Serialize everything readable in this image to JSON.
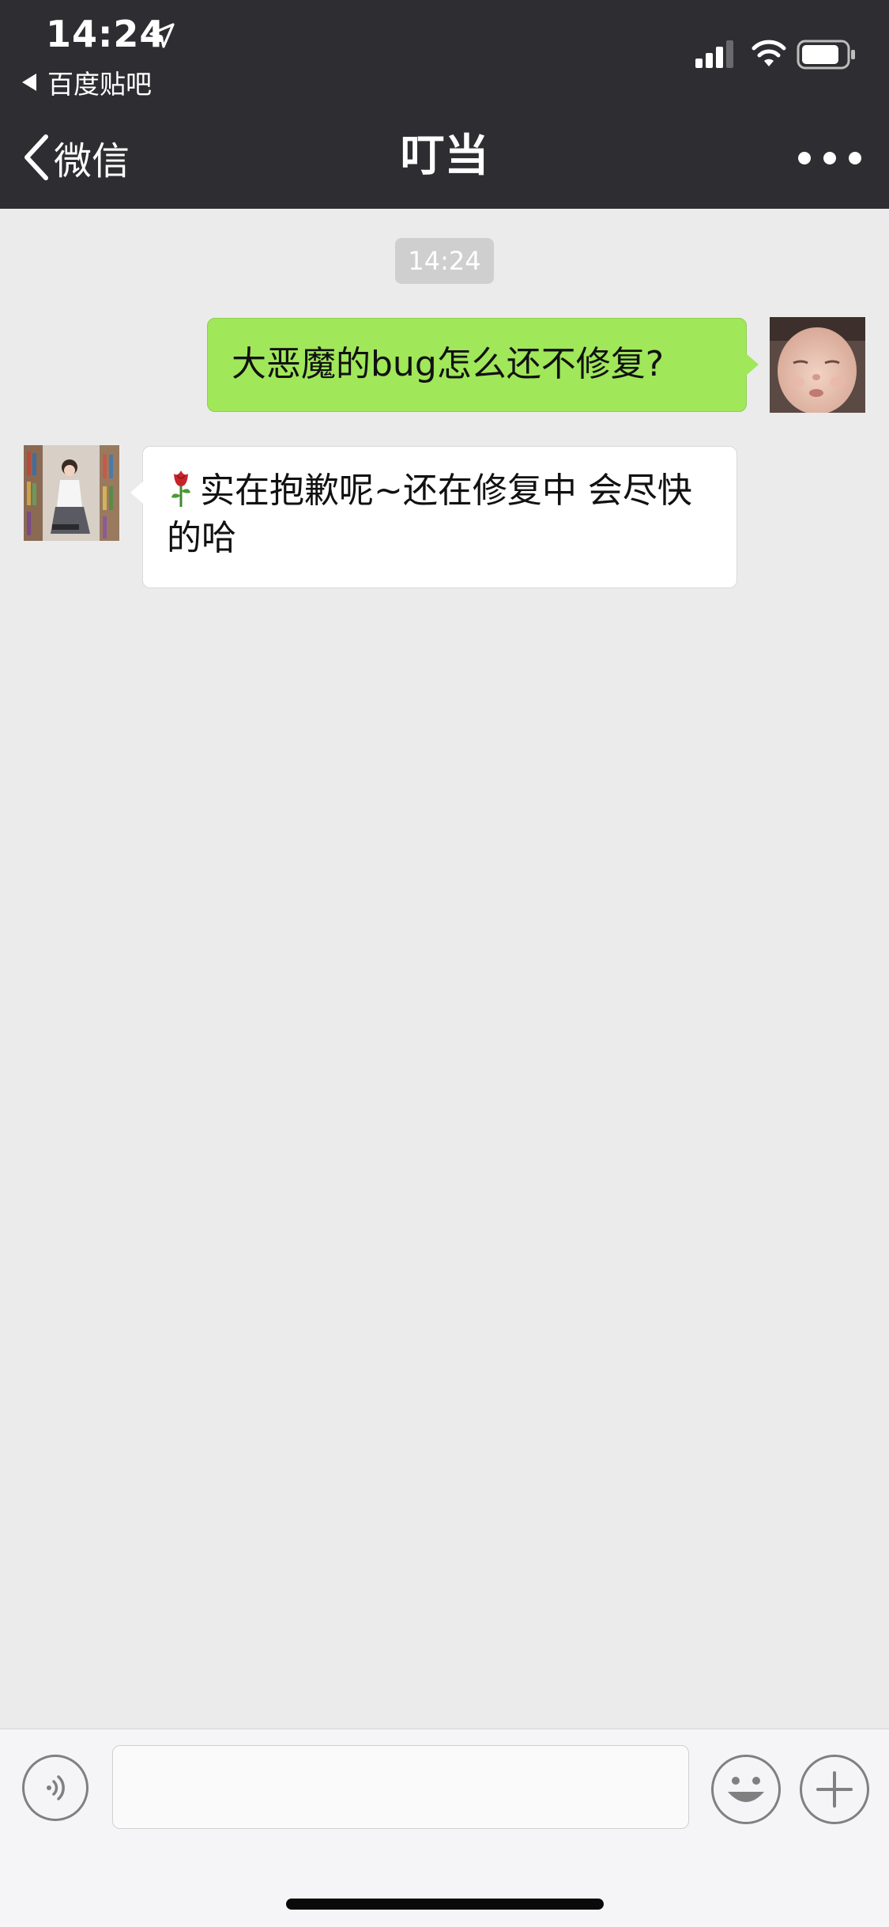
{
  "status_bar": {
    "time": "14:24",
    "back_app_label": "百度贴吧",
    "icons": [
      "location-arrow-icon",
      "cellular-signal-icon",
      "wifi-icon",
      "battery-icon"
    ]
  },
  "nav": {
    "back_label": "微信",
    "title": "叮当",
    "more_icon": "more-dots-icon"
  },
  "chat": {
    "timestamp": "14:24",
    "messages": [
      {
        "sender": "self",
        "text": "大恶魔的bug怎么还不修复?"
      },
      {
        "sender": "contact",
        "emoji": "rose-icon",
        "text": "实在抱歉呢~还在修复中 会尽快的哈"
      }
    ]
  },
  "input_bar": {
    "value": "",
    "placeholder": "",
    "icons": [
      "voice-icon",
      "emoji-icon",
      "plus-icon"
    ]
  },
  "colors": {
    "nav_background": "#2e2e32",
    "chat_background": "#ebebeb",
    "sent_bubble": "#a0e75a",
    "received_bubble": "#ffffff",
    "timestamp_badge": "#cfcfcf"
  }
}
